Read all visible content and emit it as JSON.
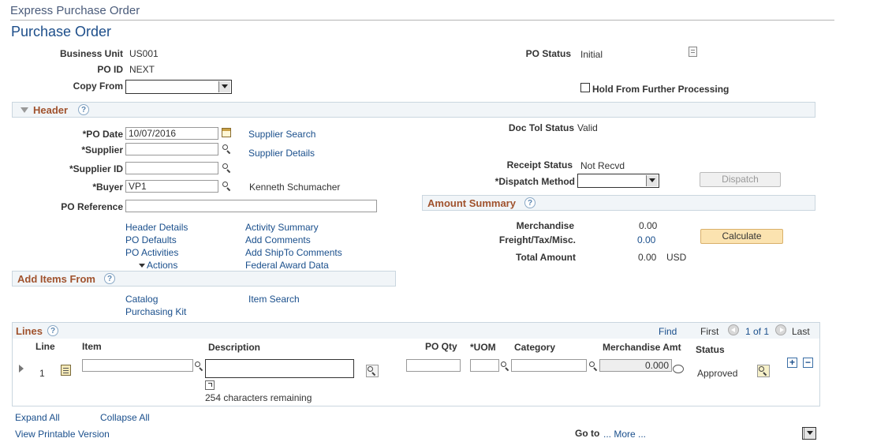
{
  "component_title": "Express Purchase Order",
  "page_title": "Purchase Order",
  "top": {
    "business_unit_label": "Business Unit",
    "business_unit": "US001",
    "po_id_label": "PO ID",
    "po_id": "NEXT",
    "copy_from_label": "Copy From",
    "copy_from_value": "",
    "po_status_label": "PO Status",
    "po_status": "Initial",
    "hold_label": "Hold From Further Processing"
  },
  "header": {
    "section_title": "Header",
    "po_date_label": "*PO Date",
    "po_date": "10/07/2016",
    "supplier_label": "*Supplier",
    "supplier": "",
    "supplier_id_label": "*Supplier ID",
    "supplier_id": "",
    "buyer_label": "*Buyer",
    "buyer": "VP1",
    "buyer_name": "Kenneth Schumacher",
    "po_reference_label": "PO Reference",
    "po_reference": "",
    "supplier_search": "Supplier Search",
    "supplier_details": "Supplier Details",
    "doc_tol_label": "Doc Tol Status",
    "doc_tol": "Valid",
    "receipt_status_label": "Receipt Status",
    "receipt_status": "Not Recvd",
    "dispatch_method_label": "*Dispatch Method",
    "dispatch_button": "Dispatch",
    "links": {
      "header_details": "Header Details",
      "po_defaults": "PO Defaults",
      "po_activities": "PO Activities",
      "actions": "Actions",
      "activity_summary": "Activity Summary",
      "add_comments": "Add Comments",
      "add_shipto_comments": "Add ShipTo Comments",
      "federal_award_data": "Federal Award Data"
    }
  },
  "amount_summary": {
    "section_title": "Amount Summary",
    "merchandise_label": "Merchandise",
    "merchandise": "0.00",
    "freight_label": "Freight/Tax/Misc.",
    "freight": "0.00",
    "total_label": "Total Amount",
    "total": "0.00",
    "currency": "USD",
    "calculate_button": "Calculate"
  },
  "add_items": {
    "section_title": "Add Items From",
    "catalog": "Catalog",
    "item_search": "Item Search",
    "purchasing_kit": "Purchasing Kit"
  },
  "lines": {
    "section_title": "Lines",
    "find": "Find",
    "first": "First",
    "range": "1 of 1",
    "last": "Last",
    "columns": {
      "line": "Line",
      "item": "Item",
      "description": "Description",
      "po_qty": "PO Qty",
      "uom": "*UOM",
      "category": "Category",
      "merch_amt": "Merchandise Amt",
      "status": "Status"
    },
    "row": {
      "line": "1",
      "merch_amt": "0.000",
      "status": "Approved",
      "chars_remaining": "254 characters remaining"
    }
  },
  "footer": {
    "expand_all": "Expand All",
    "collapse_all": "Collapse All",
    "printable": "View Printable Version",
    "goto_label": "Go to",
    "more": "... More ..."
  }
}
